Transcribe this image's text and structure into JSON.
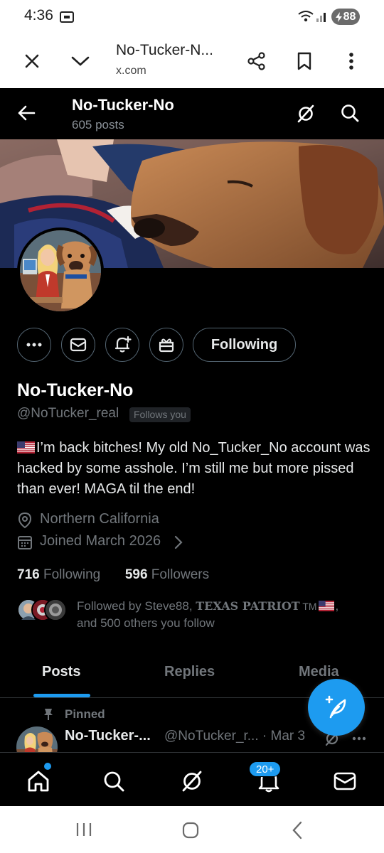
{
  "status_bar": {
    "time": "4:36",
    "battery": "88",
    "icons": [
      "cast-icon",
      "wifi-icon",
      "signal-icon",
      "battery-icon"
    ]
  },
  "browser": {
    "page_title": "No-Tucker-N...",
    "domain": "x.com",
    "icons": [
      "close-icon",
      "chevron-down-icon",
      "share-icon",
      "bookmark-icon",
      "more-vert-icon"
    ]
  },
  "header": {
    "name": "No-Tucker-No",
    "posts": "605 posts",
    "icons": [
      "back-arrow-icon",
      "grok-icon",
      "search-icon"
    ]
  },
  "profile": {
    "name": "No-Tucker-No",
    "handle": "@NoTucker_real",
    "follows_you": "Follows you",
    "following_button": "Following",
    "bio": "I’m back bitches! My old No_Tucker_No account was hacked by some asshole. I’m still me but more pissed than ever! MAGA til the end!",
    "location": "Northern California",
    "joined": "Joined March 2026",
    "following_count": "716",
    "following_label": "Following",
    "followers_count": "596",
    "followers_label": "Followers",
    "followed_by_prefix": "Followed by Steve88, ",
    "followed_by_name2": "TEXAS PATRIOT",
    "followed_by_tm": " TM",
    "followed_by_suffix": ",",
    "followed_by_line2": "and 500 others you follow"
  },
  "tabs": [
    {
      "label": "Posts",
      "active": true
    },
    {
      "label": "Replies",
      "active": false
    },
    {
      "label": "Media",
      "active": false
    }
  ],
  "post": {
    "pinned_label": "Pinned",
    "name": "No-Tucker-...",
    "meta": "@NoTucker_r... · Mar 3"
  },
  "bottom_nav": {
    "items": [
      "home-icon",
      "search-icon",
      "grok-icon",
      "notifications-icon",
      "messages-icon"
    ],
    "notifications_badge": "20+"
  },
  "colors": {
    "accent": "#1d9bf0",
    "background": "#000000",
    "text_secondary": "#71767b"
  }
}
